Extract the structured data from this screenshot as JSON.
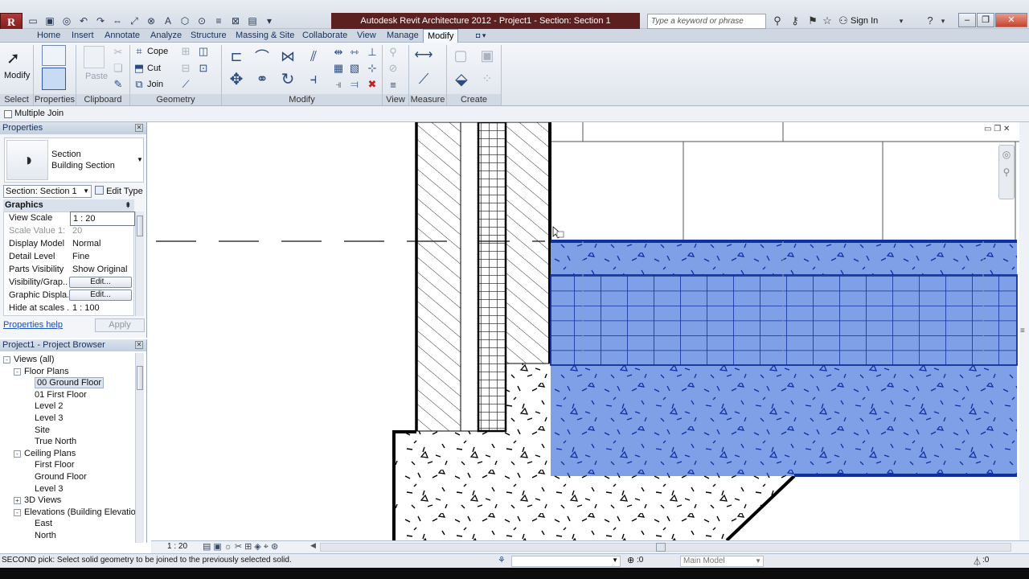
{
  "window": {
    "title": "Autodesk Revit Architecture 2012 -    Project1 - Section: Section 1",
    "search_placeholder": "Type a keyword or phrase",
    "sign_in": "Sign In"
  },
  "ribbon": {
    "tabs": [
      "Home",
      "Insert",
      "Annotate",
      "Analyze",
      "Structure",
      "Massing & Site",
      "Collaborate",
      "View",
      "Manage",
      "Modify"
    ],
    "active_tab": "Modify",
    "panels": [
      "Select",
      "Properties",
      "Clipboard",
      "Geometry",
      "Modify",
      "View",
      "Measure",
      "Create"
    ],
    "modify_label": "Modify",
    "paste_label": "Paste",
    "cope_label": "Cope",
    "cut_label": "Cut",
    "join_label": "Join"
  },
  "options_bar": {
    "multiple_join": "Multiple Join",
    "multiple_join_checked": false
  },
  "properties": {
    "header": "Properties",
    "type_category": "Section",
    "type_name": "Building Section",
    "selector_value": "Section: Section 1",
    "edit_type": "Edit Type",
    "group": "Graphics",
    "rows": [
      {
        "key": "View Scale",
        "value": "1 : 20"
      },
      {
        "key": "Scale Value    1:",
        "value": "20"
      },
      {
        "key": "Display Model",
        "value": "Normal"
      },
      {
        "key": "Detail Level",
        "value": "Fine"
      },
      {
        "key": "Parts Visibility",
        "value": "Show Original"
      },
      {
        "key": "Visibility/Grap...",
        "value": "Edit..."
      },
      {
        "key": "Graphic Displa...",
        "value": "Edit..."
      },
      {
        "key": "Hide at scales ...",
        "value": "1 : 100"
      }
    ],
    "help_link": "Properties help",
    "apply": "Apply"
  },
  "project_browser": {
    "header": "Project1 - Project Browser",
    "nodes": [
      {
        "label": "Views (all)",
        "level": 0,
        "expander": "-"
      },
      {
        "label": "Floor Plans",
        "level": 1,
        "expander": "-"
      },
      {
        "label": "00 Ground Floor",
        "level": 2,
        "expander": "",
        "selected": true
      },
      {
        "label": "01 First Floor",
        "level": 2,
        "expander": ""
      },
      {
        "label": "Level 2",
        "level": 2,
        "expander": ""
      },
      {
        "label": "Level 3",
        "level": 2,
        "expander": ""
      },
      {
        "label": "Site",
        "level": 2,
        "expander": ""
      },
      {
        "label": "True North",
        "level": 2,
        "expander": ""
      },
      {
        "label": "Ceiling Plans",
        "level": 1,
        "expander": "-"
      },
      {
        "label": "First Floor",
        "level": 2,
        "expander": ""
      },
      {
        "label": "Ground Floor",
        "level": 2,
        "expander": ""
      },
      {
        "label": "Level 3",
        "level": 2,
        "expander": ""
      },
      {
        "label": "3D Views",
        "level": 1,
        "expander": "+"
      },
      {
        "label": "Elevations (Building Elevation",
        "level": 1,
        "expander": "-"
      },
      {
        "label": "East",
        "level": 2,
        "expander": ""
      },
      {
        "label": "North",
        "level": 2,
        "expander": ""
      }
    ]
  },
  "view_control_bar": {
    "scale": "1 : 20"
  },
  "status_bar": {
    "message": "SECOND pick: Select solid geometry to be joined to the previously selected solid.",
    "selection_count": ":0",
    "model": "Main Model",
    "filter_count": ":0"
  },
  "colors": {
    "join_fill": "#7f9fe6",
    "join_stroke": "#102fa0",
    "title_bar": "#5c2020",
    "ribbon_bg": "#dfe5ed"
  }
}
